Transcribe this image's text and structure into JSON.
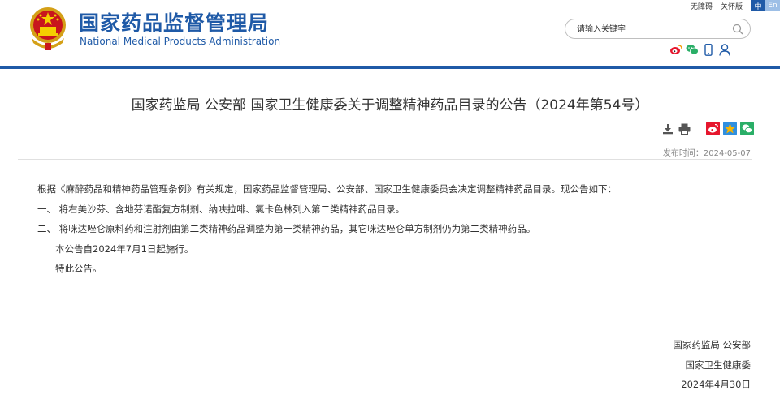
{
  "site": {
    "name_cn": "国家药品监督管理局",
    "name_en": "National Medical Products Administration"
  },
  "topbar": {
    "accessibility": "无障碍",
    "care": "关怀版",
    "lang_cn": "中",
    "lang_en": "En"
  },
  "search": {
    "placeholder": "请输入关键字"
  },
  "social_icons": [
    "weibo-icon",
    "wechat-icon",
    "mobile-icon",
    "user-icon"
  ],
  "article": {
    "title": "国家药监局 公安部 国家卫生健康委关于调整精神药品目录的公告（2024年第54号）",
    "publish_date": "发布时间：2024-05-07",
    "paragraphs": [
      "根据《麻醉药品和精神药品管理条例》有关规定，国家药品监督管理局、公安部、国家卫生健康委员会决定调整精神药品目录。现公告如下：",
      "一、  将右美沙芬、含地芬诺酯复方制剂、纳呋拉啡、氯卡色林列入第二类精神药品目录。",
      "二、  将咪达唑仑原料药和注射剂由第二类精神药品调整为第一类精神药品，其它咪达唑仑单方制剂仍为第二类精神药品。",
      "本公告自2024年7月1日起施行。",
      "特此公告。"
    ],
    "signatures": [
      "国家药监局 公安部",
      "国家卫生健康委",
      "2024年4月30日"
    ]
  },
  "colors": {
    "brand_blue": "#1f5aa7",
    "weibo_red": "#e6162d",
    "wechat_green": "#2aae67",
    "qzone_blue": "#2f8fe0",
    "star_yellow": "#f7b500"
  }
}
